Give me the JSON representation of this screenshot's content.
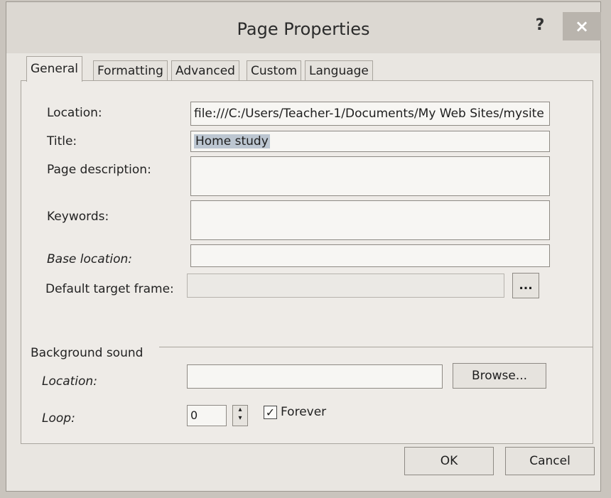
{
  "window": {
    "title": "Page Properties",
    "help_label": "?",
    "close_label": "×"
  },
  "tabs": [
    {
      "label": "General",
      "active": true
    },
    {
      "label": "Formatting",
      "active": false
    },
    {
      "label": "Advanced",
      "active": false
    },
    {
      "label": "Custom",
      "active": false
    },
    {
      "label": "Language",
      "active": false
    }
  ],
  "general": {
    "location_label": "Location:",
    "location_value": "file:///C:/Users/Teacher-1/Documents/My Web Sites/mysite",
    "title_label": "Title:",
    "title_value": "Home study",
    "description_label": "Page description:",
    "description_value": "",
    "keywords_label": "Keywords:",
    "keywords_value": "",
    "base_location_label": "Base location:",
    "base_location_value": "",
    "target_frame_label": "Default target frame:",
    "target_frame_value": "",
    "target_frame_button": "..."
  },
  "background_sound": {
    "group_label": "Background sound",
    "location_label": "Location:",
    "location_value": "",
    "browse_label": "Browse...",
    "loop_label": "Loop:",
    "loop_value": "0",
    "forever_label": "Forever",
    "forever_checked": true
  },
  "footer": {
    "ok_label": "OK",
    "cancel_label": "Cancel"
  }
}
